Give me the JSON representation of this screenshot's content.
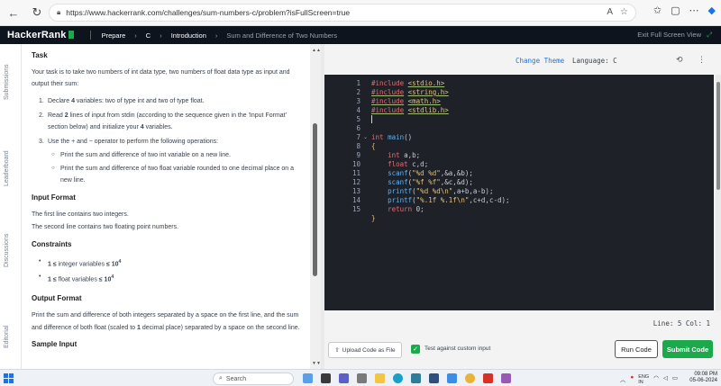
{
  "browser": {
    "url": "https://www.hackerrank.com/challenges/sum-numbers-c/problem?isFullScreen=true",
    "read_aloud": "A",
    "icons": [
      "back-icon",
      "refresh-icon",
      "lock-icon",
      "star-icon",
      "favorites-icon",
      "more-icon",
      "copilot-icon"
    ]
  },
  "header": {
    "logo": "HackerRank",
    "crumbs": [
      "Prepare",
      "C",
      "Introduction",
      "Sum and Difference of Two Numbers"
    ],
    "exit_label": "Exit Full Screen View"
  },
  "rail": {
    "tabs": [
      "Submissions",
      "Leaderboard",
      "Discussions",
      "Editorial"
    ]
  },
  "problem": {
    "task_title": "Task",
    "intro": "Your task is to take two numbers of int data type, two numbers of float data type as input and output their sum:",
    "steps": [
      {
        "num": "1.",
        "text_pre": "Declare ",
        "bold": "4",
        "text_post": " variables: two of type int and two of type float."
      },
      {
        "num": "2.",
        "text_pre": "Read ",
        "bold": "2",
        "text_post": " lines of input from stdin (according to the sequence given in the 'Input Format' section below) and initialize your ",
        "bold2": "4",
        "text_post2": " variables."
      },
      {
        "num": "3.",
        "text_pre": "Use the + and − operator to perform the following operations:",
        "bold": "",
        "text_post": ""
      }
    ],
    "sub_steps": [
      "Print the sum and difference of two int variable on a new line.",
      "Print the sum and difference of two float variable rounded to one decimal place on a new line."
    ],
    "input_title": "Input Format",
    "input_lines": [
      "The first line contains two integers.",
      "The second line contains two floating point numbers."
    ],
    "constraints_title": "Constraints",
    "constraints": [
      {
        "pre": "1 ≤ ",
        "mid": "integer variables",
        "post": " ≤ 10",
        "sup": "4"
      },
      {
        "pre": "1 ≤ ",
        "mid": "float variables",
        "post": " ≤ 10",
        "sup": "4"
      }
    ],
    "output_title": "Output Format",
    "output_text_pre": "Print the sum and difference of both integers separated by a space on the first line, and the sum and difference of both float (scaled to ",
    "output_bold": "1",
    "output_text_post": " decimal place) separated by a space on the second line.",
    "sample_title": "Sample Input"
  },
  "editor": {
    "change_theme": "Change Theme",
    "language_label": "Language:",
    "language": "C",
    "line_numbers": [
      "1",
      "2",
      "3",
      "4",
      "5",
      "6",
      "7",
      "8",
      "9",
      "10",
      "11",
      "12",
      "13",
      "14",
      "15"
    ],
    "status": "Line: 5 Col: 1"
  },
  "actions": {
    "upload": "Upload Code as File",
    "test_custom": "Test against custom input",
    "run": "Run Code",
    "submit": "Submit Code"
  },
  "taskbar": {
    "search": "Search",
    "lang": "ENG",
    "lang2": "IN",
    "time": "09:08 PM",
    "date": "05-06-2024"
  }
}
